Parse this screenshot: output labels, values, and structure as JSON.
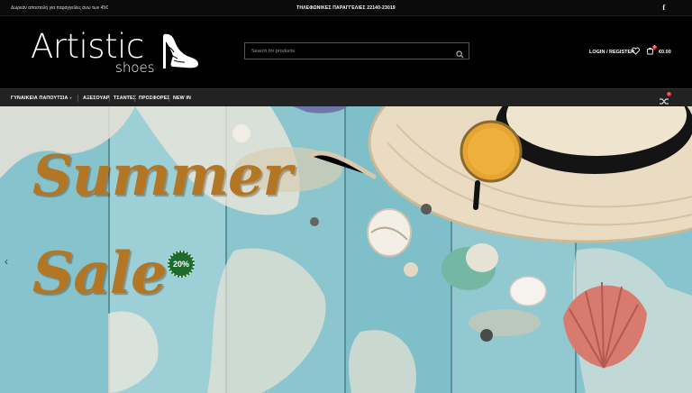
{
  "topbar": {
    "shipping_note": "Δωρεάν αποστολή για παραγγελίες άνω των 45€",
    "phone": "ΤΗΛΕΦΩΝΙΚΕΣ ΠΑΡΑΓΓΕΛΙΕΣ 22140-23019",
    "social_icon": "facebook-icon",
    "social_glyph": "f"
  },
  "header": {
    "logo_word": "Artistic",
    "logo_sub": "shoes",
    "search_placeholder": "Search for products",
    "login_label": "LOGIN / REGISTER",
    "cart_count": "0",
    "cart_total": "€0.00"
  },
  "nav": {
    "items": [
      {
        "label": "ΓΥΝΑΙΚΕΙΑ ΠΑΠΟΥΤΣΙΑ"
      },
      {
        "label": "ΑΞΕΣΟΥΑΡ"
      },
      {
        "label": "ΤΣΑΝΤΕΣ"
      },
      {
        "label": "ΠΡΟΣΦΟΡΕΣ"
      },
      {
        "label": "NEW IN"
      }
    ],
    "compare_count": "0"
  },
  "hero": {
    "line1": "Summer",
    "line2": "Sale",
    "discount": "20%",
    "prev_arrow": "‹"
  },
  "colors": {
    "headline": "#b37624",
    "badge": "#1e6b30",
    "accent_badge": "#e8312f"
  }
}
